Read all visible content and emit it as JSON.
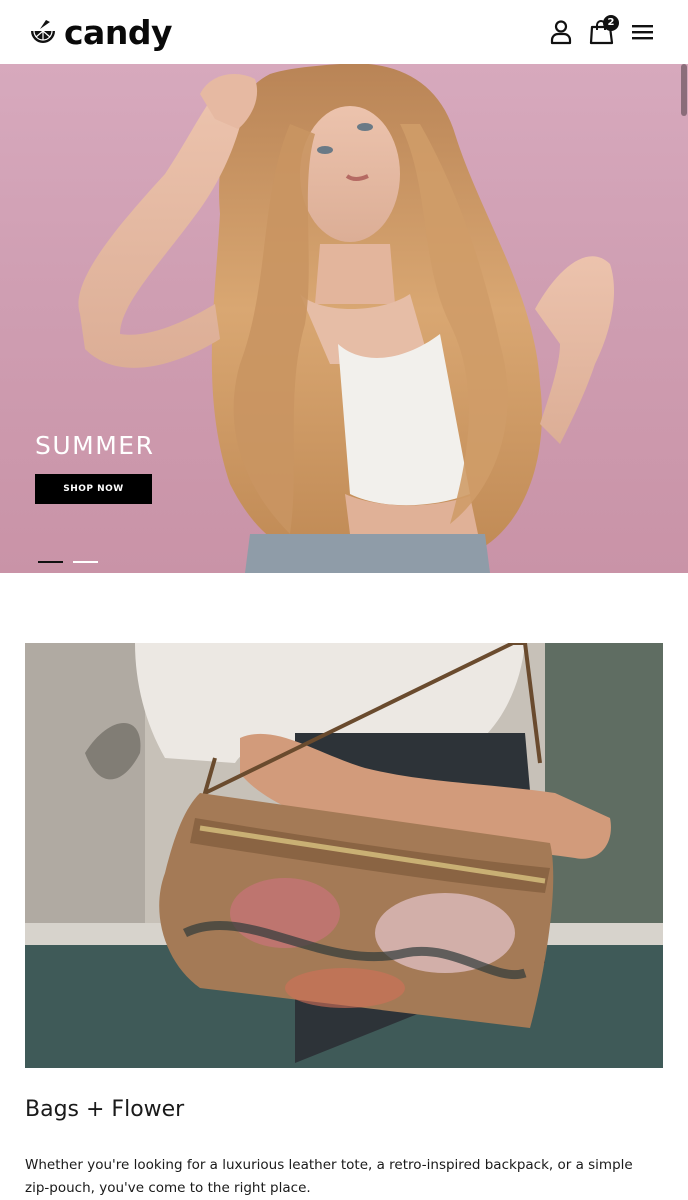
{
  "header": {
    "brand": "candy",
    "cart_count": "2",
    "icons": {
      "logo": "lemon-slice-icon",
      "account": "user-icon",
      "cart": "shopping-bag-icon",
      "menu": "hamburger-menu-icon"
    }
  },
  "hero": {
    "title": "SUMMER",
    "button_label": "SHOP NOW",
    "slides": 2,
    "active_slide": 1
  },
  "feature": {
    "title": "Bags + Flower",
    "description": "Whether you're looking for a luxurious leather tote, a retro-inspired backpack, or a simple zip-pouch, you've come to the right place."
  },
  "colors": {
    "accent": "#000000",
    "hero_background": "#d7a9bd",
    "text": "#1a1a1a"
  }
}
